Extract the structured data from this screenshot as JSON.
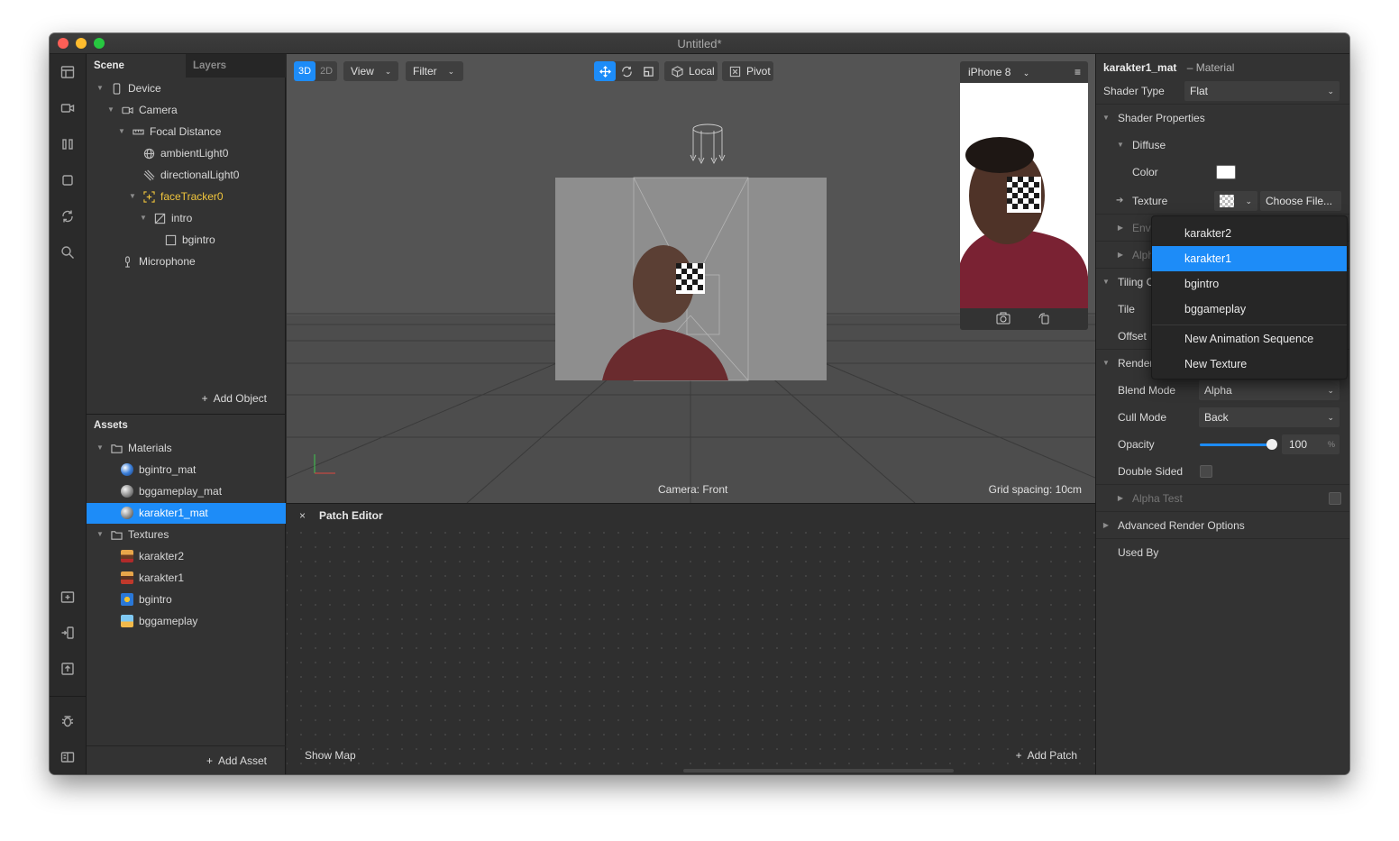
{
  "window": {
    "title": "Untitled*"
  },
  "scene_panel": {
    "tabs": [
      "Scene",
      "Layers"
    ],
    "tree": [
      {
        "label": "Device",
        "icon": "phone-icon"
      },
      {
        "label": "Camera",
        "icon": "camera-icon"
      },
      {
        "label": "Focal Distance",
        "icon": "ruler-icon"
      },
      {
        "label": "ambientLight0",
        "icon": "globe-icon"
      },
      {
        "label": "directionalLight0",
        "icon": "directional-light-icon"
      },
      {
        "label": "faceTracker0",
        "icon": "face-tracker-icon"
      },
      {
        "label": "intro",
        "icon": "rectangle-icon"
      },
      {
        "label": "bgintro",
        "icon": "square-icon"
      },
      {
        "label": "Microphone",
        "icon": "microphone-icon"
      }
    ],
    "add_label": "Add Object"
  },
  "assets_panel": {
    "title": "Assets",
    "items": [
      {
        "label": "Materials",
        "icon": "folder-icon"
      },
      {
        "label": "bgintro_mat",
        "icon": "material-sphere-icon"
      },
      {
        "label": "bggameplay_mat",
        "icon": "material-sphere-icon"
      },
      {
        "label": "karakter1_mat",
        "icon": "material-sphere-icon"
      },
      {
        "label": "Textures",
        "icon": "folder-icon"
      },
      {
        "label": "karakter2",
        "icon": "texture-thumbnail"
      },
      {
        "label": "karakter1",
        "icon": "texture-thumbnail"
      },
      {
        "label": "bgintro",
        "icon": "texture-thumbnail"
      },
      {
        "label": "bggameplay",
        "icon": "texture-thumbnail"
      }
    ],
    "selected": "karakter1_mat",
    "add_label": "Add Asset"
  },
  "viewport": {
    "mode_3d": "3D",
    "mode_2d": "2D",
    "view_label": "View",
    "filter_label": "Filter",
    "local_label": "Local",
    "pivot_label": "Pivot",
    "camera_label": "Camera: Front",
    "grid_label": "Grid spacing: 10cm",
    "device_label": "iPhone 8"
  },
  "patch_editor": {
    "close": "×",
    "title": "Patch Editor",
    "show_map": "Show Map",
    "add_patch": "Add Patch"
  },
  "inspector": {
    "object_name": "karakter1_mat",
    "object_type": "– Material",
    "shader_type_label": "Shader Type",
    "shader_type_value": "Flat",
    "shader_properties_label": "Shader Properties",
    "diffuse_label": "Diffuse",
    "color_label": "Color",
    "texture_label": "Texture",
    "choose_file_label": "Choose File...",
    "env_label": "Envi",
    "alpha_label": "Alph",
    "tiling_label": "Tiling C",
    "tile_label": "Tile",
    "offset_label": "Offset",
    "render_label": "Render",
    "blend_mode_label": "Blend Mode",
    "blend_mode_value": "Alpha",
    "cull_mode_label": "Cull Mode",
    "cull_mode_value": "Back",
    "opacity_label": "Opacity",
    "opacity_value": "100",
    "opacity_unit": "%",
    "double_sided_label": "Double Sided",
    "alpha_test_label": "Alpha Test",
    "advanced_label": "Advanced Render Options",
    "used_by_label": "Used By"
  },
  "texture_dropdown": {
    "items": [
      "karakter2",
      "karakter1",
      "bgintro",
      "bggameplay"
    ],
    "actions": [
      "New Animation Sequence",
      "New Texture"
    ],
    "selected": "karakter1"
  },
  "colors": {
    "accent": "#1d8cf8",
    "highlight_yellow": "#f0c53c"
  }
}
